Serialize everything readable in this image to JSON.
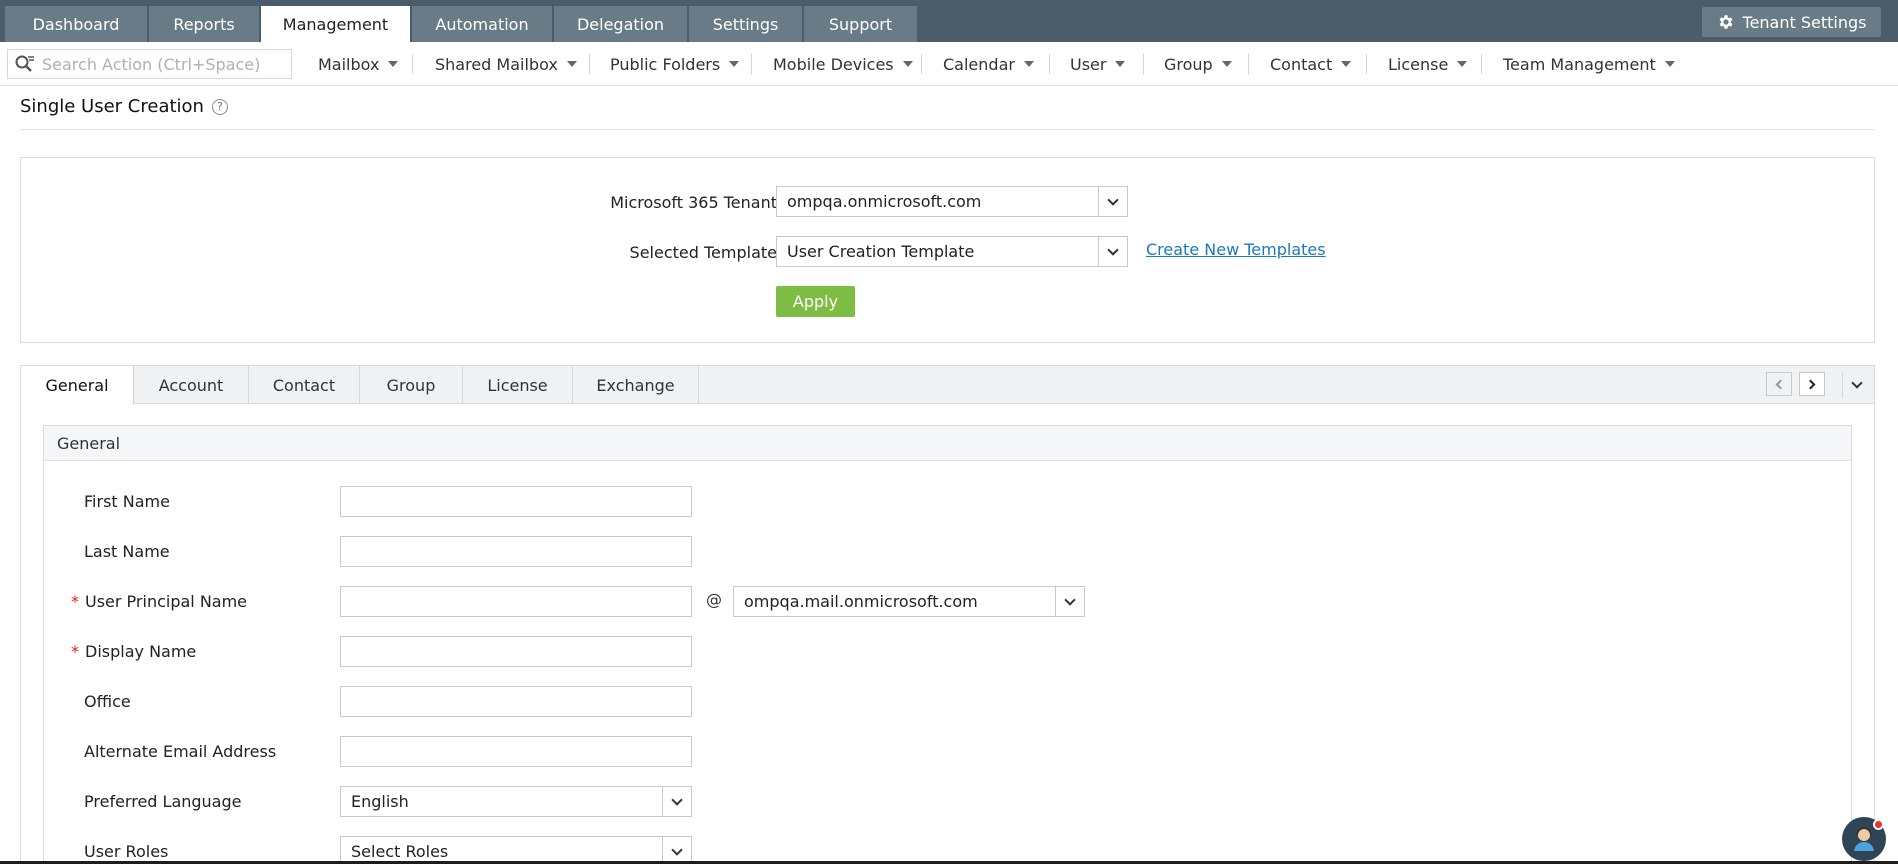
{
  "topnav": {
    "tabs": [
      {
        "label": "Dashboard",
        "active": false
      },
      {
        "label": "Reports",
        "active": false
      },
      {
        "label": "Management",
        "active": true
      },
      {
        "label": "Automation",
        "active": false
      },
      {
        "label": "Delegation",
        "active": false
      },
      {
        "label": "Settings",
        "active": false
      },
      {
        "label": "Support",
        "active": false
      }
    ],
    "tenant_settings_label": "Tenant Settings"
  },
  "subnav": {
    "search_placeholder": "Search Action (Ctrl+Space)",
    "menus": [
      "Mailbox",
      "Shared Mailbox",
      "Public Folders",
      "Mobile Devices",
      "Calendar",
      "User",
      "Group",
      "Contact",
      "License",
      "Team Management"
    ]
  },
  "page": {
    "title": "Single User Creation",
    "help_glyph": "?"
  },
  "tenant_box": {
    "tenant_label": "Microsoft 365 Tenant",
    "tenant_value": "ompqa.onmicrosoft.com",
    "template_label": "Selected Template",
    "template_value": "User Creation Template",
    "create_templates_link": "Create New Templates",
    "apply_label": "Apply"
  },
  "tabs": {
    "items": [
      "General",
      "Account",
      "Contact",
      "Group",
      "License",
      "Exchange"
    ],
    "active": "General"
  },
  "general": {
    "section_title": "General",
    "fields": {
      "first_name": {
        "label": "First Name",
        "value": ""
      },
      "last_name": {
        "label": "Last Name",
        "value": ""
      },
      "upn": {
        "label": "User Principal Name",
        "value": "",
        "required": true,
        "at": "@",
        "domain": "ompqa.mail.onmicrosoft.com"
      },
      "display_name": {
        "label": "Display Name",
        "value": "",
        "required": true
      },
      "office": {
        "label": "Office",
        "value": ""
      },
      "alt_email": {
        "label": "Alternate Email Address",
        "value": ""
      },
      "preferred_language": {
        "label": "Preferred Language",
        "value": "English"
      },
      "user_roles": {
        "label": "User Roles",
        "value": "Select Roles"
      }
    },
    "required_marker": "*"
  },
  "colors": {
    "topnav_bg": "#4b5d6b",
    "tab_bg": "#6a7b88",
    "apply_green": "#7dbd44",
    "link_blue": "#1a79c4",
    "required_red": "#e02020"
  }
}
